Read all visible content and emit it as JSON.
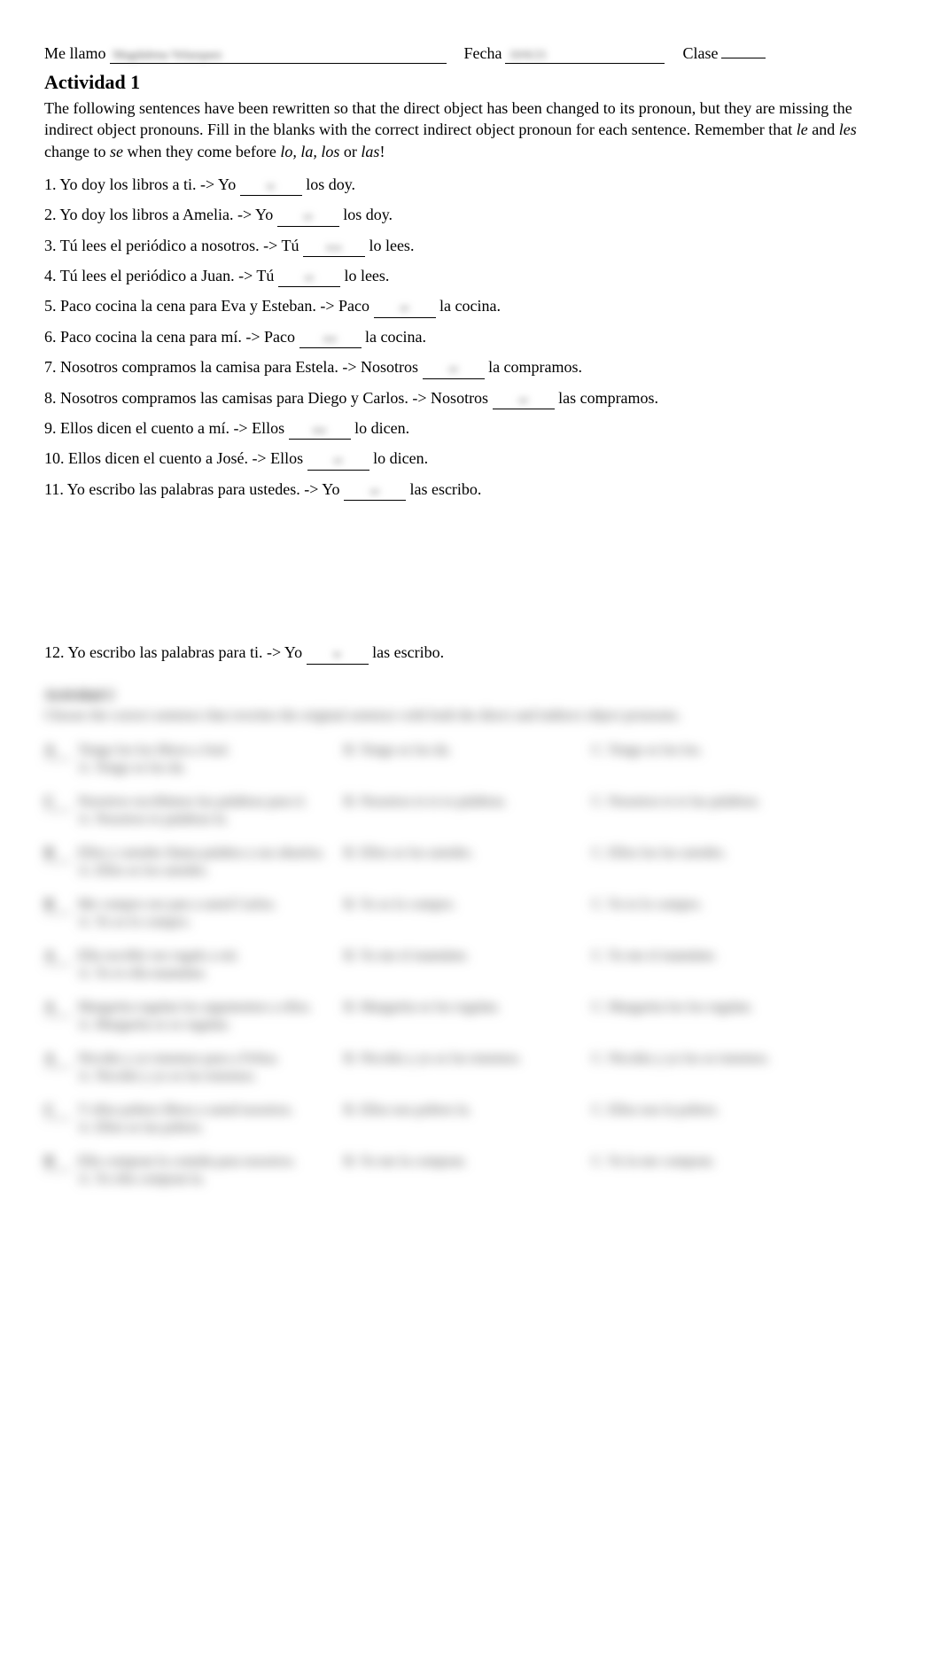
{
  "header": {
    "name_label": "Me llamo",
    "name_value": "Magdalena Velazquez",
    "fecha_label": "Fecha",
    "fecha_value": "10/6/21",
    "clase_label": "Clase"
  },
  "activity1": {
    "title": "Actividad 1",
    "instructions_pre": "The following sentences have been rewritten so that the direct object has been changed to its pronoun, but they are missing the indirect object pronouns.  Fill in the blanks with the correct indirect object pronoun for each sentence.  Remember that ",
    "instructions_le": "le",
    "instructions_and": " and ",
    "instructions_les": "les",
    "instructions_mid": " change to ",
    "instructions_se": "se",
    "instructions_mid2": " when they come before ",
    "instructions_lo": "lo, la, los",
    "instructions_or": " or ",
    "instructions_las": "las",
    "instructions_end": "!",
    "questions": [
      {
        "num": "1.",
        "before": "Yo doy los libros a ti.  ->  Yo ",
        "answer": "te",
        "after": " los doy."
      },
      {
        "num": "2.",
        "before": "Yo doy los libros a Amelia.  ->  Yo ",
        "answer": "se",
        "after": " los doy."
      },
      {
        "num": "3.",
        "before": "Tú lees el periódico a nosotros.  ->  Tú ",
        "answer": "nos",
        "after": " lo lees."
      },
      {
        "num": "4.",
        "before": "Tú lees el periódico a Juan.  ->   Tú ",
        "answer": "se",
        "after": " lo lees."
      },
      {
        "num": "5.",
        "before": "Paco cocina la cena para Eva y Esteban.   ->   Paco ",
        "answer": "se",
        "after": " la cocina."
      },
      {
        "num": "6.",
        "before": "Paco cocina la cena para mí.   ->  Paco ",
        "answer": "me",
        "after": " la cocina."
      },
      {
        "num": "7.",
        "before": "Nosotros compramos la camisa para Estela.  ->  Nosotros ",
        "answer": "se",
        "after": " la compramos."
      },
      {
        "num": "8.",
        "before": "Nosotros compramos las camisas para Diego y Carlos.  ->  Nosotros ",
        "answer": "se",
        "after": " las compramos."
      },
      {
        "num": "9.",
        "before": "Ellos dicen el cuento a mí.  ->  Ellos ",
        "answer": "me",
        "after": " lo dicen."
      },
      {
        "num": "10.",
        "before": "Ellos dicen el cuento a José.  ->  Ellos ",
        "answer": "se",
        "after": " lo dicen."
      },
      {
        "num": "11.",
        "before": "Yo escribo las palabras para ustedes.  ->  Yo ",
        "answer": "se",
        "after": " las escribo."
      }
    ],
    "question12": {
      "num": "12.",
      "before": "Yo escribo las palabras para ti.  ->   Yo ",
      "answer": "te",
      "after": " las escribo."
    }
  },
  "activity2": {
    "title": "Actividad 2",
    "instructions": "Choose the correct sentence that rewrites the original sentence with both the direct and indirect object pronouns.",
    "items": [
      {
        "num": "A",
        "prompt": "Tengo los los libros a José.",
        "a": "A. Tengo se los da.",
        "b": "B. Tengo se los da.",
        "c": "C. Tengo se los los."
      },
      {
        "num": "C",
        "prompt": "Nosotros escribimos las palabras para ti.",
        "a": "A. Nosotros te palabras la.",
        "b": "B. Nosotros te te te palabras.",
        "c": "C. Nosotros te te las palabras."
      },
      {
        "num": "B",
        "prompt": "Ellos y ustedes llama palabra a sus abuelos.",
        "a": "A. Ellos se los ustedes.",
        "b": "B. Ellos se los ustedes.",
        "c": "C. Ellos los los ustedes."
      },
      {
        "num": "B",
        "prompt": "Me compro ese pan a usted Carlos.",
        "a": "A. Yo se lo compro.",
        "b": "B. Yo se lo compro.",
        "c": "C. Yo te lo compro."
      },
      {
        "num": "A",
        "prompt": "Ella escribir ese regalo a mí.",
        "a": "A. Yo te ella mamáme.",
        "b": "B. Yo me el mamáme.",
        "c": "C. Yo me el mamáme."
      },
      {
        "num": "A",
        "prompt": "Margarita regalan los argumentos a ellos.",
        "a": "A. Margarita se se regalan.",
        "b": "B. Margarita se los regalan.",
        "c": "C. Margarita los los regalan."
      },
      {
        "num": "A",
        "prompt": "Nicolás y yo tenemos para a Felisa.",
        "a": "A. Nicolás y yo se los tenemos.",
        "b": "B. Nicolás y yo se los tenemos.",
        "c": "C. Nicolás y yo los se tenemos."
      },
      {
        "num": "C",
        "prompt": "Y ellos pobres libros a usted nosotros.",
        "a": "A. Ellos se las pobres.",
        "b": "B. Ellos nos pobres la.",
        "c": "C. Ellos nos la pobres."
      },
      {
        "num": "B",
        "prompt": "Ella compran la comida para nosotros.",
        "a": "A. Yo ella compran la.",
        "b": "B. Yo me la compran.",
        "c": "C. Yo la me compran."
      }
    ]
  }
}
